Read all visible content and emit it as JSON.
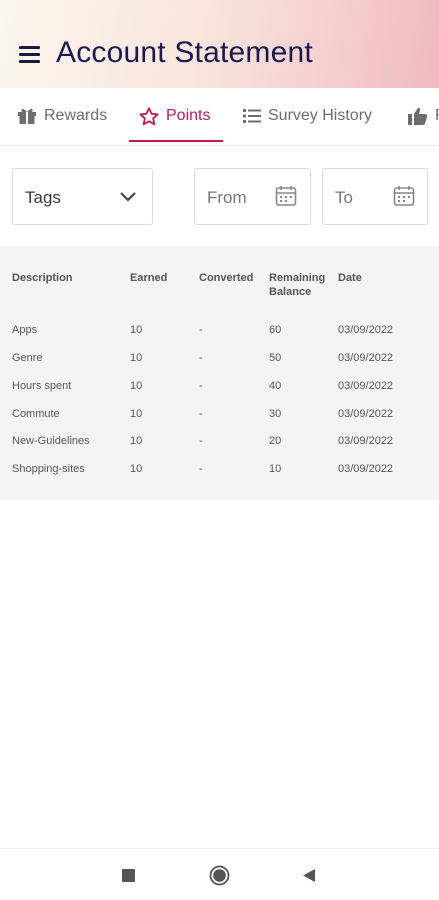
{
  "header": {
    "title": "Account Statement",
    "menu_icon": "hamburger-menu-icon",
    "gradient_colors": [
      "#fcf6ee",
      "#f5cfd0",
      "#f0b8bf"
    ],
    "title_color": "#1a1a52"
  },
  "tabs": [
    {
      "label": "Rewards",
      "icon": "gift-icon",
      "active": false
    },
    {
      "label": "Points",
      "icon": "star-icon",
      "active": true
    },
    {
      "label": "Survey History",
      "icon": "list-icon",
      "active": false
    },
    {
      "label": "R",
      "icon": "thumbs-up-icon",
      "active": false
    }
  ],
  "accent_color": "#c2185b",
  "filters": {
    "tags_label": "Tags",
    "from_label": "From",
    "to_label": "To"
  },
  "table": {
    "headers": {
      "description": "Description",
      "earned": "Earned",
      "converted": "Converted",
      "remaining": "Remaining Balance",
      "date": "Date"
    },
    "rows": [
      {
        "description": "Apps",
        "earned": "10",
        "converted": "-",
        "remaining": "60",
        "date": "03/09/2022"
      },
      {
        "description": "Genre",
        "earned": "10",
        "converted": "-",
        "remaining": "50",
        "date": "03/09/2022"
      },
      {
        "description": "Hours spent",
        "earned": "10",
        "converted": "-",
        "remaining": "40",
        "date": "03/09/2022"
      },
      {
        "description": "Commute",
        "earned": "10",
        "converted": "-",
        "remaining": "30",
        "date": "03/09/2022"
      },
      {
        "description": "New-Guidelines",
        "earned": "10",
        "converted": "-",
        "remaining": "20",
        "date": "03/09/2022"
      },
      {
        "description": "Shopping-sites",
        "earned": "10",
        "converted": "-",
        "remaining": "10",
        "date": "03/09/2022"
      }
    ]
  },
  "system_nav": [
    "recent-apps-icon",
    "home-icon",
    "back-icon"
  ]
}
